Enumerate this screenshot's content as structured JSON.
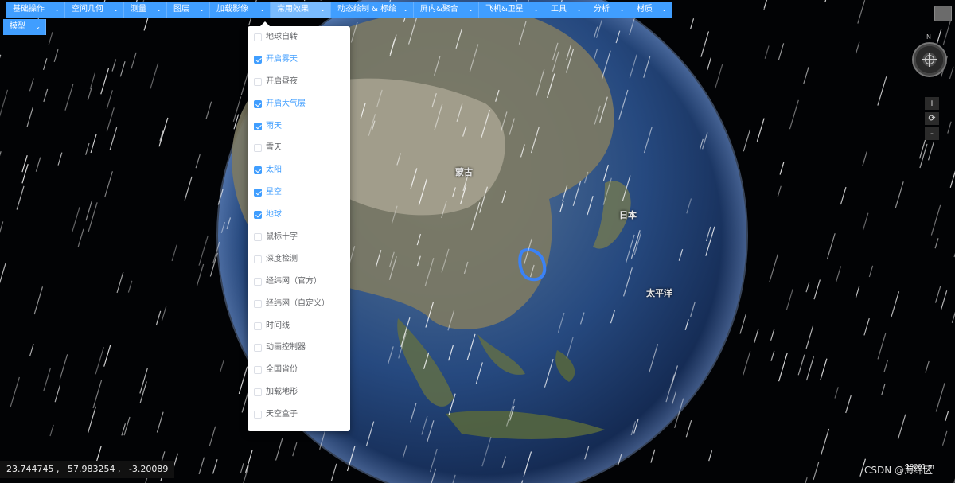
{
  "menubar": {
    "items": [
      {
        "label": "基础操作"
      },
      {
        "label": "空间几何"
      },
      {
        "label": "测量"
      },
      {
        "label": "图层"
      },
      {
        "label": "加载影像"
      },
      {
        "label": "常用效果"
      },
      {
        "label": "动态绘制 & 标绘"
      },
      {
        "label": "屏内&聚合"
      },
      {
        "label": "飞机&卫星"
      },
      {
        "label": "工具"
      },
      {
        "label": "分析"
      },
      {
        "label": "材质"
      },
      {
        "label": "模型"
      }
    ],
    "active": "常用效果"
  },
  "effects_dropdown": {
    "options": [
      {
        "label": "地球自转",
        "checked": false
      },
      {
        "label": "开启雾天",
        "checked": true
      },
      {
        "label": "开启昼夜",
        "checked": false
      },
      {
        "label": "开启大气层",
        "checked": true
      },
      {
        "label": "雨天",
        "checked": true
      },
      {
        "label": "雪天",
        "checked": false
      },
      {
        "label": "太阳",
        "checked": true
      },
      {
        "label": "星空",
        "checked": true
      },
      {
        "label": "地球",
        "checked": true
      },
      {
        "label": "鼠标十字",
        "checked": false
      },
      {
        "label": "深度检测",
        "checked": false
      },
      {
        "label": "经纬网（官方）",
        "checked": false
      },
      {
        "label": "经纬网（自定义）",
        "checked": false
      },
      {
        "label": "时间线",
        "checked": false
      },
      {
        "label": "动画控制器",
        "checked": false
      },
      {
        "label": "全国省份",
        "checked": false
      },
      {
        "label": "加载地形",
        "checked": false
      },
      {
        "label": "天空盒子",
        "checked": false
      }
    ]
  },
  "navigation": {
    "north_label": "N",
    "zoom_in": "+",
    "reset": "⟳",
    "zoom_out": "-"
  },
  "map_labels": {
    "mongolia": "蒙古",
    "japan": "日本",
    "pacific": "太平洋"
  },
  "status": {
    "coordinates": "23.744745 ,   57.983254 ,   -3.20089",
    "scale": "19001 m",
    "watermark": "CSDN @海绵区"
  },
  "colors": {
    "accent": "#409eff",
    "ocean": "#1d3f7a",
    "rain": "#ffffff"
  }
}
